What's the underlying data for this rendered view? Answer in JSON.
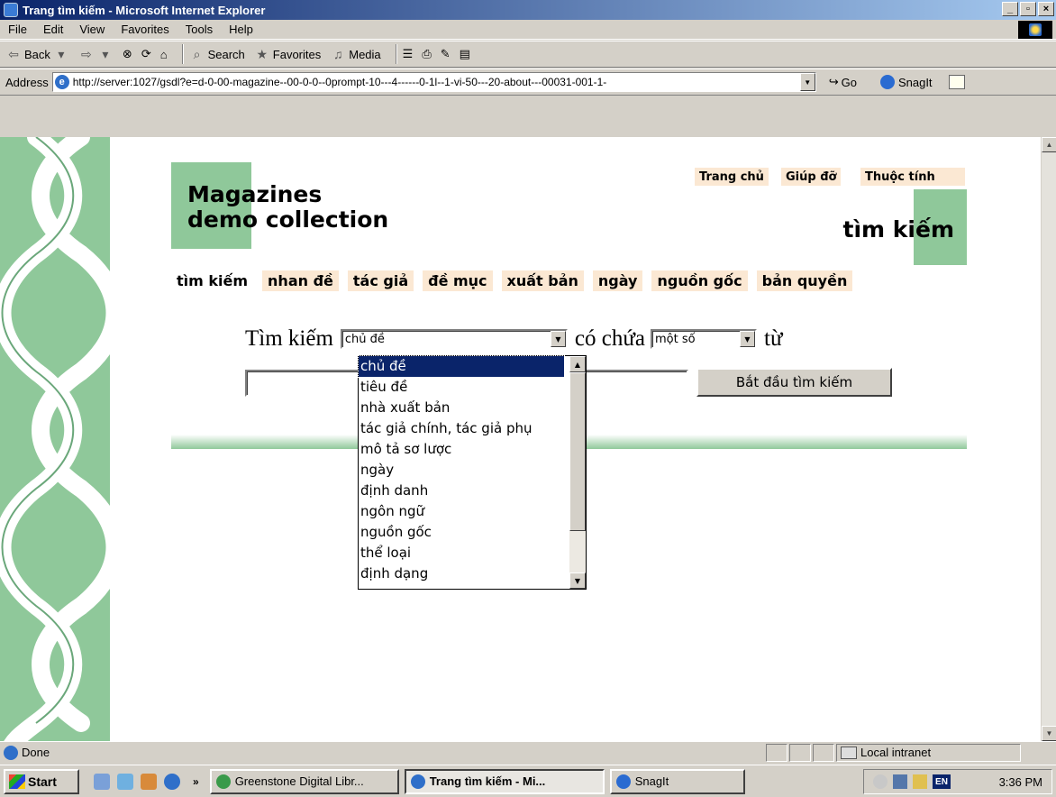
{
  "window": {
    "title": "Trang tìm kiếm - Microsoft Internet Explorer"
  },
  "menu": [
    "File",
    "Edit",
    "View",
    "Favorites",
    "Tools",
    "Help"
  ],
  "toolbar": {
    "back": "Back",
    "search": "Search",
    "favorites": "Favorites",
    "media": "Media"
  },
  "address": {
    "label": "Address",
    "url": "http://server:1027/gsdl?e=d-0-00-magazine--00-0-0--0prompt-10---4------0-1l--1-vi-50---20-about---00031-001-1-",
    "go": "Go",
    "snagit": "SnagIt"
  },
  "page": {
    "collection_title_line1": "Magazines",
    "collection_title_line2": "demo collection",
    "top_links": [
      "Trang chủ",
      "Giúp đỡ",
      "Thuộc tính"
    ],
    "page_title": "tìm kiếm",
    "nav": [
      "tìm kiếm",
      "nhan đề",
      "tác giả",
      "đề mục",
      "xuất bản",
      "ngày",
      "nguồn gốc",
      "bản quyền"
    ],
    "search": {
      "label_prefix": "Tìm kiếm",
      "field_selected": "chủ đề",
      "label_contains": "có chứa",
      "mode_selected": "một số",
      "label_words": "từ",
      "button": "Bắt đầu tìm kiếm",
      "query_value": ""
    },
    "field_options": [
      "chủ đề",
      "tiêu đề",
      "nhà xuất bản",
      "tác giả chính, tác giả phụ",
      "mô tả sơ lược",
      "ngày",
      "định danh",
      "ngôn ngữ",
      "nguồn gốc",
      "thể loại",
      "định dạng"
    ]
  },
  "status": {
    "text": "Done",
    "zone": "Local intranet"
  },
  "taskbar": {
    "start": "Start",
    "tasks": [
      "Greenstone Digital Libr...",
      "Trang tìm kiếm - Mi...",
      "SnagIt"
    ],
    "lang": "EN",
    "clock": "3:36 PM"
  },
  "colors": {
    "accent_green": "#8fc89a",
    "tab_bg": "#fbe8d3",
    "title_blue": "#0a246a"
  }
}
